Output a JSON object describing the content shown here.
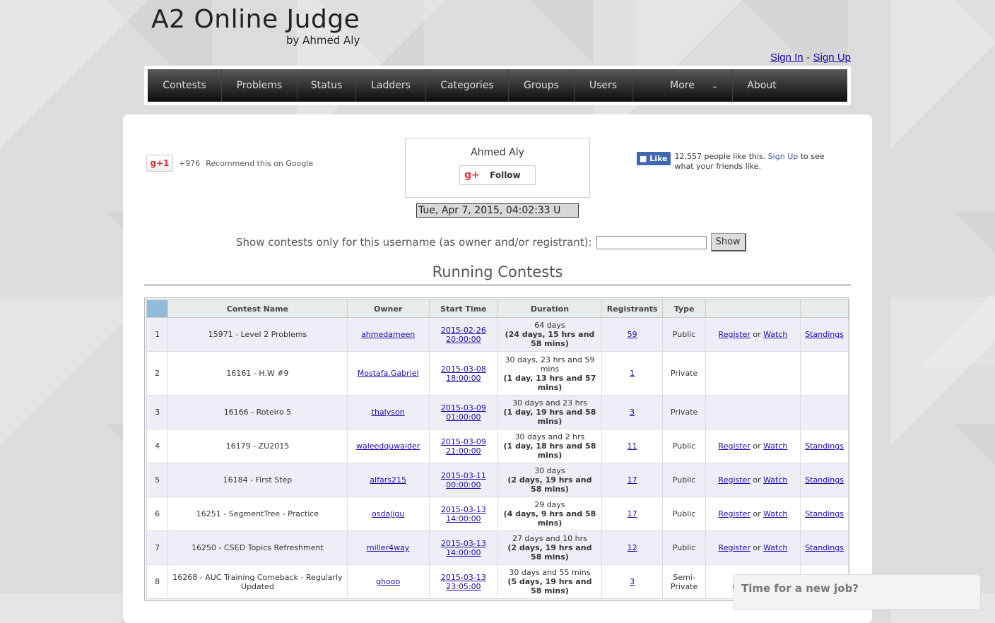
{
  "logo": {
    "title": "A2 Online Judge",
    "subtitle": "by Ahmed Aly"
  },
  "auth": {
    "sign_in": "Sign In",
    "separator": "-",
    "sign_up": "Sign Up"
  },
  "nav": [
    {
      "label": "Contests"
    },
    {
      "label": "Problems"
    },
    {
      "label": "Status"
    },
    {
      "label": "Ladders"
    },
    {
      "label": "Categories"
    },
    {
      "label": "Groups"
    },
    {
      "label": "Users"
    },
    {
      "label": "More"
    },
    {
      "label": "About"
    }
  ],
  "social": {
    "gplus_btn": "g+1",
    "gplus_count": "+976",
    "gplus_text": "Recommend this on Google",
    "follow_name": "Ahmed Aly",
    "follow_btn": "Follow",
    "follow_g": "g+",
    "fb_like": "Like",
    "fb_text_pre": "12,557 people like this. ",
    "fb_signup": "Sign Up",
    "fb_text_post": " to see what your friends like."
  },
  "clock": "Tue, Apr 7, 2015, 04:02:33 U",
  "filter": {
    "label": "Show contests only for this username (as owner and/or registrant):",
    "value": "",
    "button": "Show"
  },
  "section_title": "Running Contests",
  "table": {
    "headers": [
      "",
      "Contest Name",
      "Owner",
      "Start Time",
      "Duration",
      "Registrants",
      "Type",
      "",
      ""
    ],
    "rows": [
      {
        "n": "1",
        "name": "15971 - Level 2 Problems",
        "owner": "ahmedameen",
        "start1": "2015-02-26",
        "start2": "20:00:00",
        "dur": "64 days",
        "dur_b": "(24 days, 15 hrs and 58 mins)",
        "reg": "59",
        "type": "Public",
        "action": "rw",
        "standings": "Standings"
      },
      {
        "n": "2",
        "name": "16161 - H.W #9",
        "owner": "Mostafa.Gabriel",
        "start1": "2015-03-08",
        "start2": "18:00:00",
        "dur": "30 days, 23 hrs and 59 mins",
        "dur_b": "(1 day, 13 hrs and 57 mins)",
        "reg": "1",
        "type": "Private",
        "action": "",
        "standings": ""
      },
      {
        "n": "3",
        "name": "16166 - Roteiro 5",
        "owner": "thalyson",
        "start1": "2015-03-09",
        "start2": "01:00:00",
        "dur": "30 days and 23 hrs",
        "dur_b": "(1 day, 19 hrs and 58 mins)",
        "reg": "3",
        "type": "Private",
        "action": "",
        "standings": ""
      },
      {
        "n": "4",
        "name": "16179 - ZU2015",
        "owner": "waleedquwaider",
        "start1": "2015-03-09",
        "start2": "21:00:00",
        "dur": "30 days and 2 hrs",
        "dur_b": "(1 day, 18 hrs and 58 mins)",
        "reg": "11",
        "type": "Public",
        "action": "rw",
        "standings": "Standings"
      },
      {
        "n": "5",
        "name": "16184 - First Step",
        "owner": "alfars215",
        "start1": "2015-03-11",
        "start2": "00:00:00",
        "dur": "30 days",
        "dur_b": "(2 days, 19 hrs and 58 mins)",
        "reg": "17",
        "type": "Public",
        "action": "rw",
        "standings": "Standings"
      },
      {
        "n": "6",
        "name": "16251 - SegmentTree - Practice",
        "owner": "osdajigu",
        "start1": "2015-03-13",
        "start2": "14:00:00",
        "dur": "29 days",
        "dur_b": "(4 days, 9 hrs and 58 mins)",
        "reg": "17",
        "type": "Public",
        "action": "rw",
        "standings": "Standings"
      },
      {
        "n": "7",
        "name": "16250 - CSED Topics Refreshment",
        "owner": "miller4way",
        "start1": "2015-03-13",
        "start2": "14:00:00",
        "dur": "27 days and 10 hrs",
        "dur_b": "(2 days, 19 hrs and 58 mins)",
        "reg": "12",
        "type": "Public",
        "action": "rw",
        "standings": "Standings"
      },
      {
        "n": "8",
        "name": "16268 - AUC Training Comeback - Regularly Updated",
        "owner": "ghooo",
        "start1": "2015-03-13",
        "start2": "23:05:00",
        "dur": "30 days and 55 mins",
        "dur_b": "(5 days, 19 hrs and 58 mins)",
        "reg": "3",
        "type": "Semi-Private",
        "action": "semi",
        "standings": ""
      }
    ],
    "register": "Register",
    "or": "or",
    "watch": "Watch",
    "semi_note": "(Re... inv..."
  },
  "job_widget": "Time for a new job?"
}
